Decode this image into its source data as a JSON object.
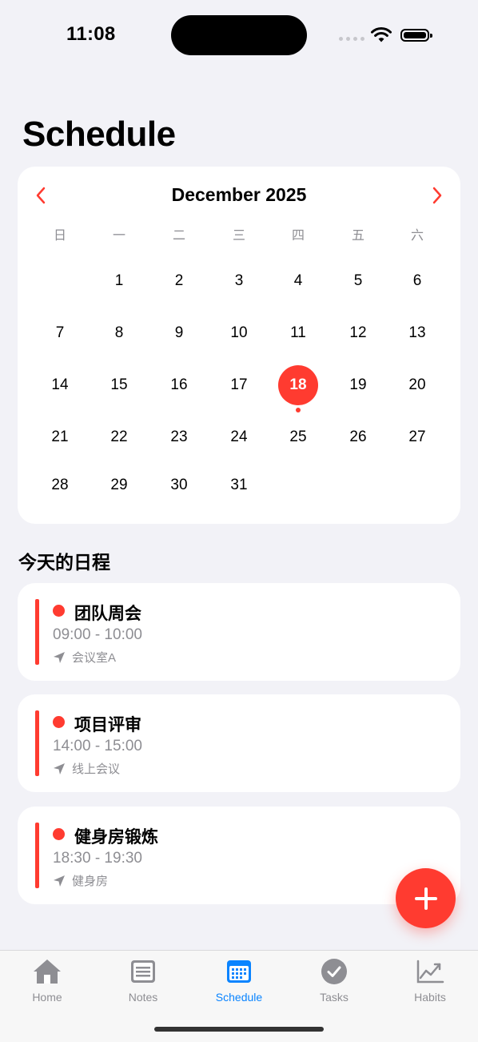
{
  "status_bar": {
    "time": "11:08"
  },
  "page": {
    "title": "Schedule"
  },
  "calendar": {
    "month_label": "December 2025",
    "weekdays": [
      "日",
      "一",
      "二",
      "三",
      "四",
      "五",
      "六"
    ],
    "days": [
      [
        "",
        "1",
        "2",
        "3",
        "4",
        "5",
        "6"
      ],
      [
        "7",
        "8",
        "9",
        "10",
        "11",
        "12",
        "13"
      ],
      [
        "14",
        "15",
        "16",
        "17",
        "18",
        "19",
        "20"
      ],
      [
        "21",
        "22",
        "23",
        "24",
        "25",
        "26",
        "27"
      ],
      [
        "28",
        "29",
        "30",
        "31",
        "",
        "",
        ""
      ]
    ],
    "selected_day": "18",
    "days_with_events": [
      "18"
    ],
    "accent_color": "#FF3B30"
  },
  "today_section": {
    "title": "今天的日程",
    "events": [
      {
        "title": "团队周会",
        "time": "09:00 - 10:00",
        "location": "会议室A",
        "color": "#FF3B30"
      },
      {
        "title": "项目评审",
        "time": "14:00 - 15:00",
        "location": "线上会议",
        "color": "#FF3B30"
      },
      {
        "title": "健身房锻炼",
        "time": "18:30 - 19:30",
        "location": "健身房",
        "color": "#FF3B30"
      }
    ]
  },
  "fab": {
    "icon": "plus-icon"
  },
  "tab_bar": {
    "active_color": "#0A84FF",
    "items": [
      {
        "label": "Home",
        "icon": "house-icon"
      },
      {
        "label": "Notes",
        "icon": "notes-icon"
      },
      {
        "label": "Schedule",
        "icon": "calendar-icon",
        "active": true
      },
      {
        "label": "Tasks",
        "icon": "checkmark-circle-icon"
      },
      {
        "label": "Habits",
        "icon": "chart-line-icon"
      }
    ]
  }
}
